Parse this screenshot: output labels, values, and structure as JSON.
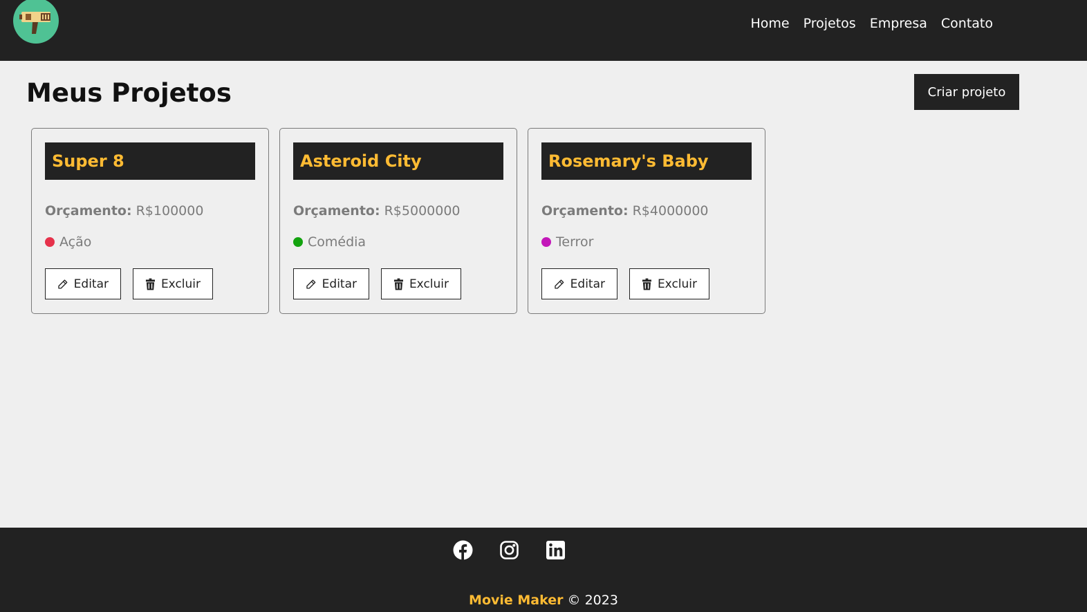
{
  "nav": {
    "logo_icon": "film-camera-logo",
    "links": [
      "Home",
      "Projetos",
      "Empresa",
      "Contato"
    ]
  },
  "main": {
    "title": "Meus Projetos",
    "create_button": "Criar projeto"
  },
  "projects": [
    {
      "name": "Super 8",
      "budget_label": "Orçamento:",
      "budget_value": " R$100000",
      "category": "Ação",
      "category_color": "#e6324b",
      "edit_label": "Editar",
      "delete_label": "Excluir"
    },
    {
      "name": "Asteroid City",
      "budget_label": "Orçamento:",
      "budget_value": " R$5000000",
      "category": "Comédia",
      "category_color": "#13a30f",
      "edit_label": "Editar",
      "delete_label": "Excluir"
    },
    {
      "name": "Rosemary's Baby",
      "budget_label": "Orçamento:",
      "budget_value": " R$4000000",
      "category": "Terror",
      "category_color": "#c317b9",
      "edit_label": "Editar",
      "delete_label": "Excluir"
    }
  ],
  "footer": {
    "social_icons": [
      "facebook-icon",
      "instagram-icon",
      "linkedin-icon"
    ],
    "brand": "Movie Maker",
    "copyright": " © 2023"
  },
  "colors": {
    "dark": "#222222",
    "accent": "#ffbb33",
    "background": "#efefef",
    "logo_bg": "#4fc294"
  }
}
